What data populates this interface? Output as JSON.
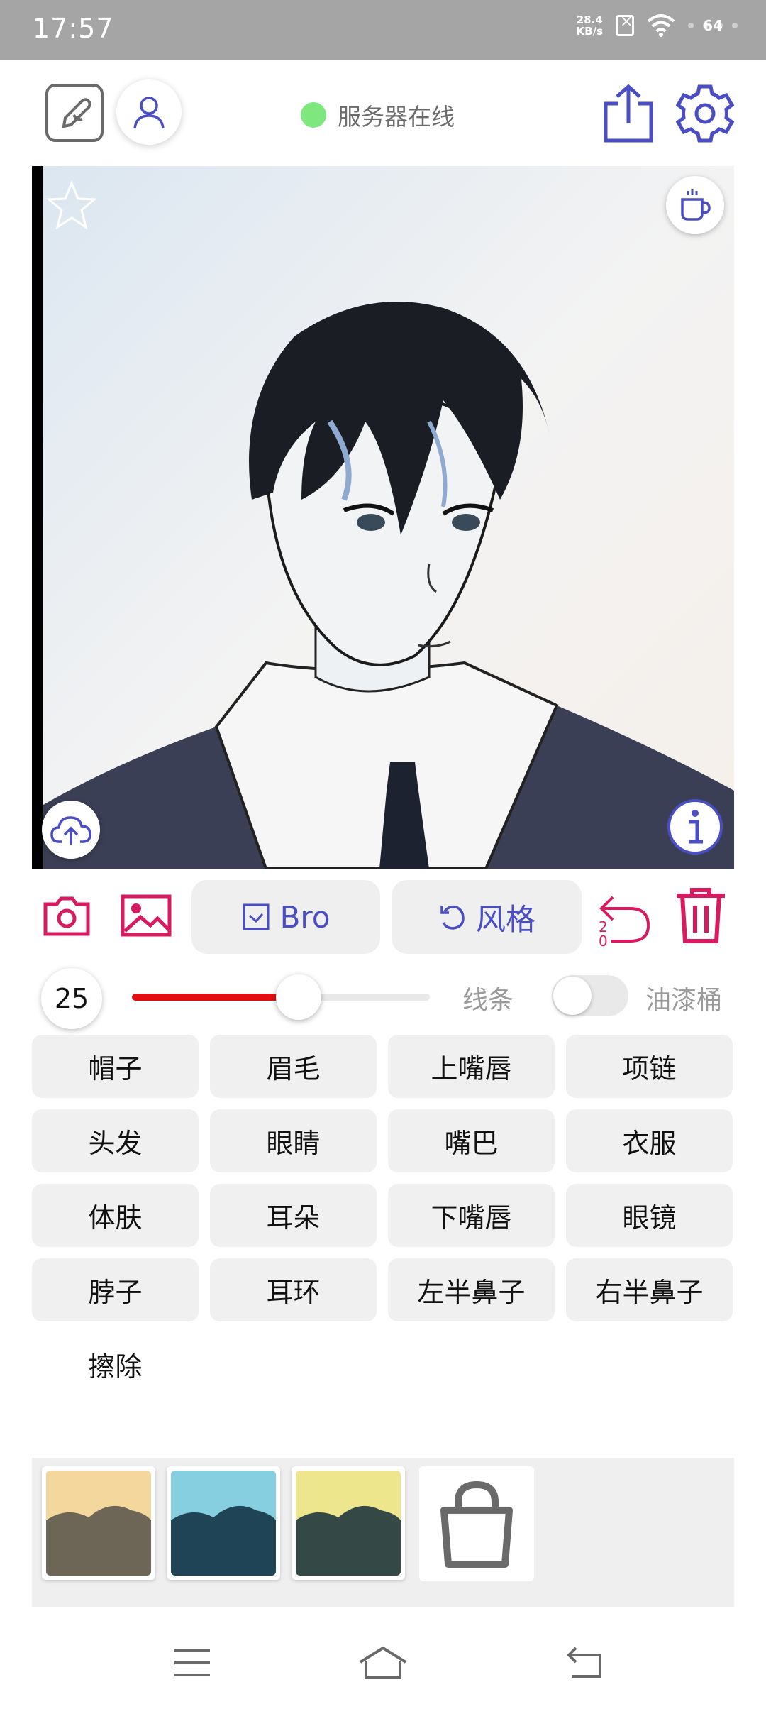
{
  "status_bar": {
    "time": "17:57",
    "net_speed_value": "28.4",
    "net_speed_unit": "KB/s",
    "battery": "64"
  },
  "header": {
    "server_status": "服务器在线",
    "server_status_color": "#7ee77e",
    "icons": [
      "edit-icon",
      "user-icon",
      "share-icon",
      "gear-icon"
    ]
  },
  "canvas": {
    "icons": [
      "star-icon",
      "coffee-icon",
      "upload-cloud-icon",
      "info-icon"
    ]
  },
  "toolbar": {
    "bro_label": "Bro",
    "style_label": "风格",
    "undo_count_top": "2",
    "undo_count_bottom": "0",
    "accent_color": "#d81b60",
    "pill_text_color": "#4a4ec4"
  },
  "brush": {
    "size": "25",
    "slider_fraction": 0.56,
    "line_label": "线条",
    "bucket_label": "油漆桶",
    "bucket_enabled": false
  },
  "parts": [
    [
      "帽子",
      "眉毛",
      "上嘴唇",
      "项链"
    ],
    [
      "头发",
      "眼睛",
      "嘴巴",
      "衣服"
    ],
    [
      "体肤",
      "耳朵",
      "下嘴唇",
      "眼镜"
    ],
    [
      "脖子",
      "耳环",
      "左半鼻子",
      "右半鼻子"
    ],
    [
      "擦除"
    ]
  ],
  "palette": {
    "swatches": [
      {
        "top": "#f3d79c",
        "bottom": "#6d6657"
      },
      {
        "top": "#86cfe0",
        "bottom": "#1f4455"
      },
      {
        "top": "#eee68c",
        "bottom": "#344846"
      }
    ],
    "store_icon": "shopping-bag-icon"
  },
  "navbar": {
    "icons": [
      "menu-icon",
      "home-icon",
      "back-icon"
    ]
  }
}
